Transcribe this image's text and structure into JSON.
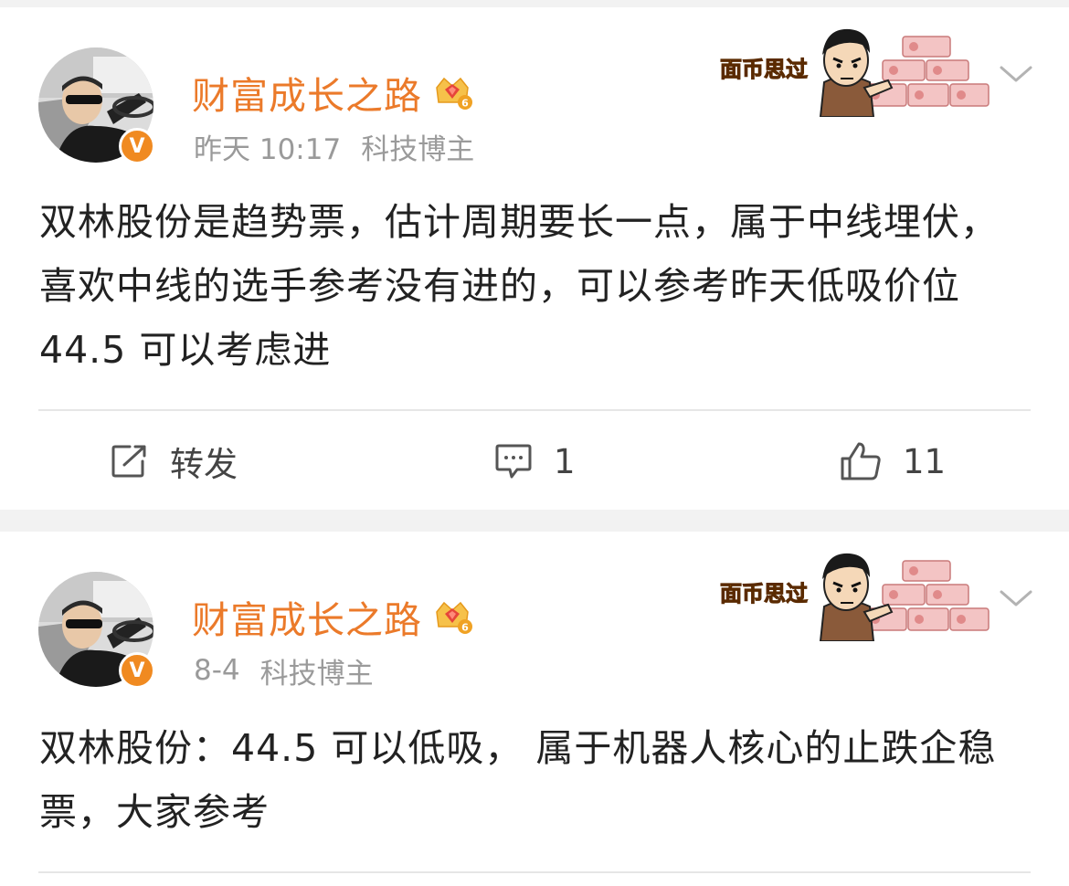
{
  "posts": [
    {
      "username": "财富成长之路",
      "timestamp": "昨天 10:17",
      "source": "科技博主",
      "sticker_text": "面币思过",
      "verified_mark": "V",
      "text": "双林股份是趋势票，估计周期要长一点，属于中线埋伏，喜欢中线的选手参考没有进的，可以参考昨天低吸价位 44.5 可以考虑进",
      "actions": {
        "repost_label": "转发",
        "comment_count": "1",
        "like_count": "11"
      }
    },
    {
      "username": "财富成长之路",
      "timestamp": "8-4",
      "source": "科技博主",
      "sticker_text": "面币思过",
      "verified_mark": "V",
      "text": "双林股份：44.5 可以低吸， 属于机器人核心的止跌企稳票，大家参考"
    }
  ],
  "colors": {
    "username": "#eb7a2a",
    "verified_badge": "#f08a21",
    "meta_text": "#9a9a9a",
    "body_text": "#222222",
    "background": "#f2f2f2"
  },
  "icons": {
    "vip": "crown-gem-icon",
    "verified": "verified-v-icon",
    "menu": "chevron-down-icon",
    "repost": "repost-icon",
    "comment": "comment-icon",
    "like": "thumbs-up-icon"
  }
}
